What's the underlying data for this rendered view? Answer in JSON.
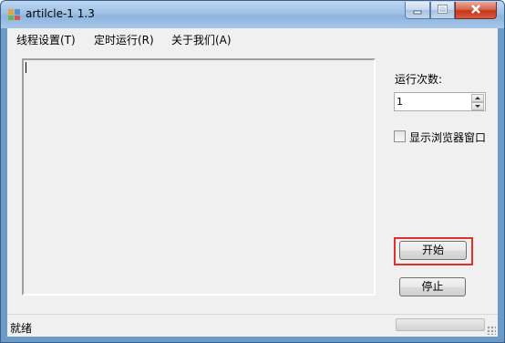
{
  "window": {
    "title": "artilcle-1 1.3"
  },
  "menu": {
    "items": [
      "线程设置(T)",
      "定时运行(R)",
      "关于我们(A)"
    ]
  },
  "main": {
    "log_text": "",
    "run_count_label": "运行次数:",
    "run_count_value": "1",
    "show_browser_label": "显示浏览器窗口",
    "show_browser_checked": false,
    "start_button": "开始",
    "stop_button": "停止"
  },
  "status": {
    "text": "就绪",
    "progress": 0
  },
  "colors": {
    "highlight": "#e0302c",
    "title_gradient_top": "#bcd6f0",
    "close_button": "#c2361b"
  }
}
